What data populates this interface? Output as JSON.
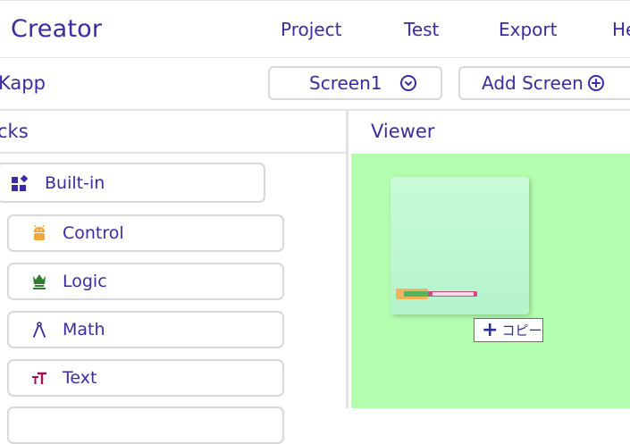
{
  "header": {
    "brand": "Creator",
    "menu": [
      "Project",
      "Test",
      "Export",
      "He"
    ]
  },
  "toolbar": {
    "project_name": "Kapp",
    "screen_select": "Screen1",
    "add_screen": "Add Screen"
  },
  "panels": {
    "blocks_title": "cks",
    "viewer_title": "Viewer"
  },
  "categories": [
    {
      "label": "Built-in",
      "icon": "builtin-icon",
      "color": "#3e2aa0"
    },
    {
      "label": "Control",
      "icon": "control-icon",
      "color": "#f2a93b"
    },
    {
      "label": "Logic",
      "icon": "logic-icon",
      "color": "#2e7d32"
    },
    {
      "label": "Math",
      "icon": "math-icon",
      "color": "#3e2aa0"
    },
    {
      "label": "Text",
      "icon": "text-icon",
      "color": "#a0115c"
    }
  ],
  "viewer": {
    "copy_label": "コピー"
  }
}
